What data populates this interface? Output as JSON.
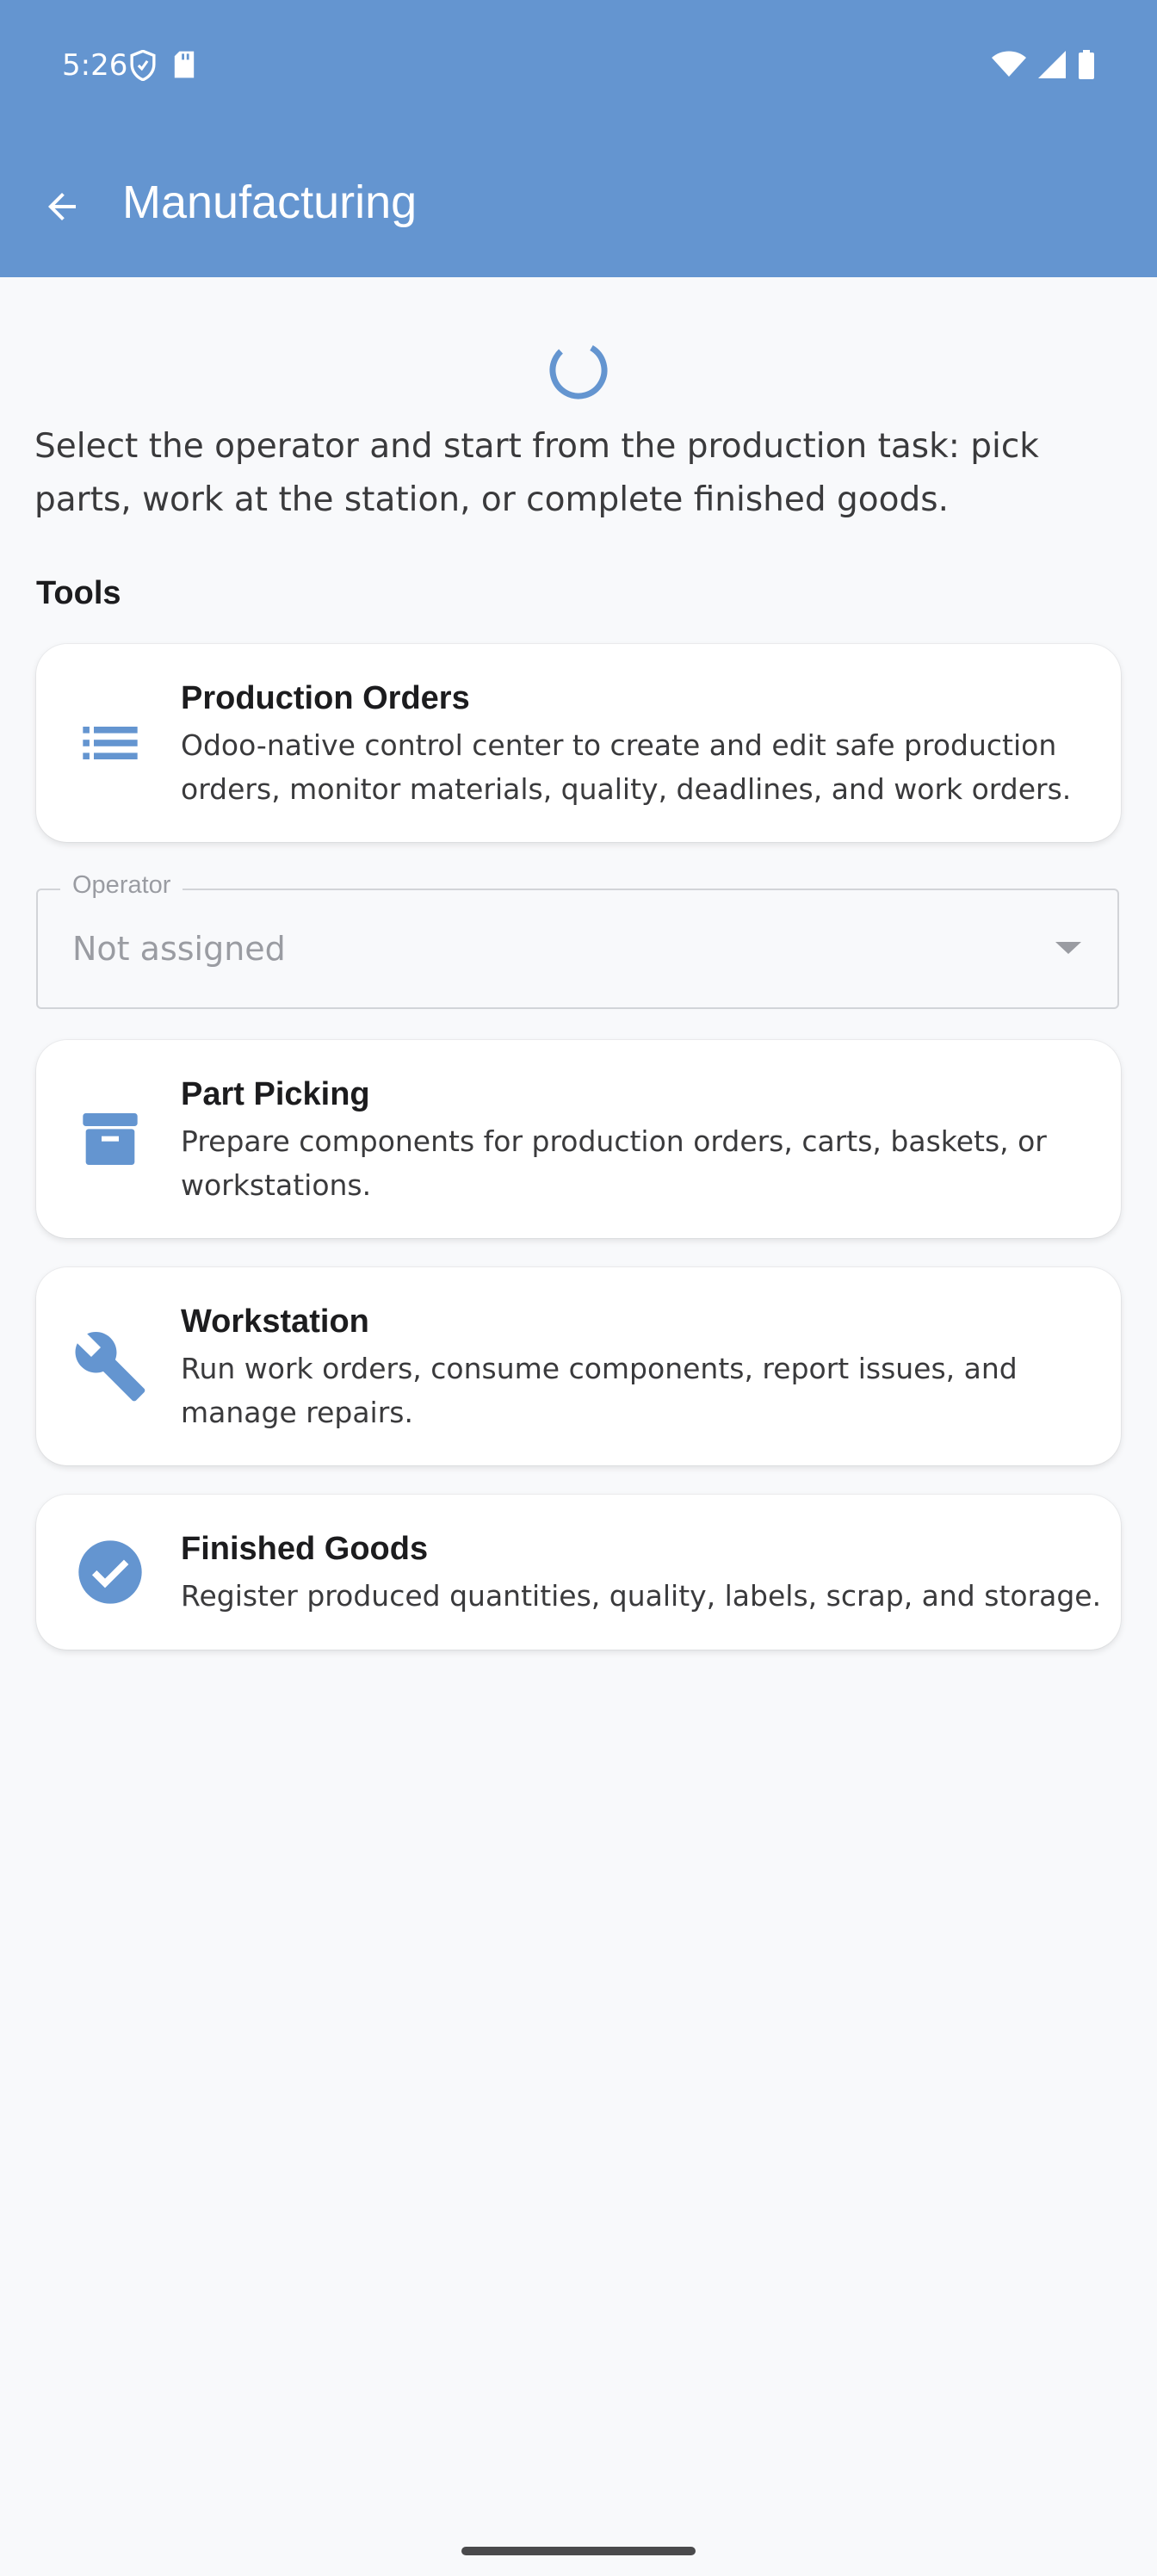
{
  "status_bar": {
    "time": "5:26",
    "left_icons": [
      "shield-icon",
      "sd-card-icon"
    ],
    "right_icons": [
      "wifi-icon",
      "signal-icon",
      "battery-icon"
    ]
  },
  "app_bar": {
    "title": "Manufacturing",
    "back_icon": "arrow-back-icon"
  },
  "intro": "Select the operator and start from the production task: pick parts, work at the station, or complete finished goods.",
  "tools_label": "Tools",
  "cards": [
    {
      "icon": "list-icon",
      "title": "Production Orders",
      "description": "Odoo-native control center to create and edit safe production orders, monitor materials, quality, deadlines, and work orders."
    },
    {
      "icon": "archive-box-icon",
      "title": "Part Picking",
      "description": "Prepare components for production orders, carts, baskets, or workstations."
    },
    {
      "icon": "wrench-icon",
      "title": "Workstation",
      "description": "Run work orders, consume components, report issues, and manage repairs."
    },
    {
      "icon": "check-circle-icon",
      "title": "Finished Goods",
      "description": "Register produced quantities, quality, labels, scrap, and storage."
    }
  ],
  "operator": {
    "label": "Operator",
    "value": "Not assigned"
  },
  "colors": {
    "primary": "#6495d0",
    "background": "#f8f9fb",
    "card": "#ffffff"
  }
}
